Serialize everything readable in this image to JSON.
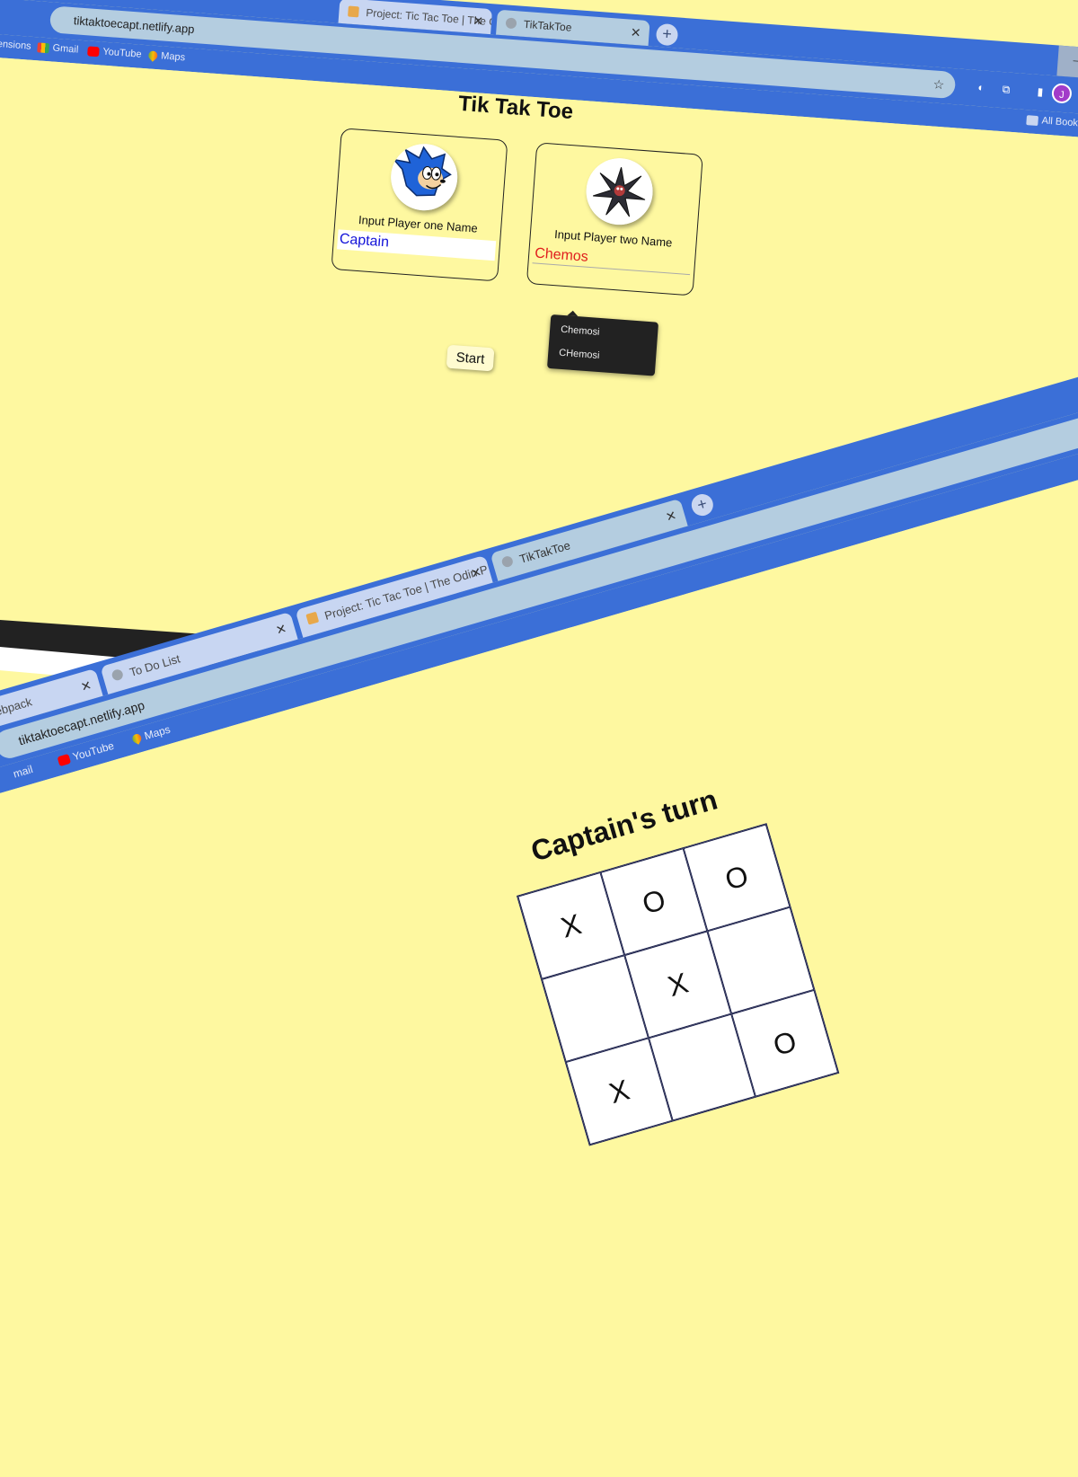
{
  "shot1": {
    "tabs": [
      {
        "label": "Project: Tic Tac Toe | The Odin P"
      },
      {
        "label": "TikTakToe"
      }
    ],
    "address": "tiktaktoecapt.netlify.app",
    "bookmarks": [
      {
        "label": "Gmail"
      },
      {
        "label": "YouTube"
      },
      {
        "label": "Maps"
      }
    ],
    "bookmarks_left_fragment": "tensions",
    "all_bookmarks": "All Bookm",
    "avatar_letter": "J",
    "page": {
      "title": "Tik Tak Toe",
      "player_one": {
        "label": "Input Player one Name",
        "value": "Captain"
      },
      "player_two": {
        "label": "Input Player two Name",
        "value": "Chemos"
      },
      "start_label": "Start",
      "autocomplete": [
        "Chemosi",
        "CHemosi"
      ]
    }
  },
  "shot2": {
    "tabs": [
      {
        "label": "ebpack"
      },
      {
        "label": "To Do List"
      },
      {
        "label": "Project: Tic Tac Toe | The Odin P"
      },
      {
        "label": "TikTakToe"
      }
    ],
    "address": "tiktaktoecapt.netlify.app",
    "bookmarks": [
      {
        "label": "mail"
      },
      {
        "label": "YouTube"
      },
      {
        "label": "Maps"
      }
    ],
    "page": {
      "turn": "Captain's turn",
      "board": [
        "X",
        "O",
        "O",
        "",
        "X",
        "",
        "X",
        "",
        "O"
      ]
    }
  },
  "colors": {
    "page_background": "#fef8a0",
    "chrome_blue": "#3b6fd7",
    "player_one_text": "#1212d8",
    "player_two_text": "#e01e1e"
  }
}
